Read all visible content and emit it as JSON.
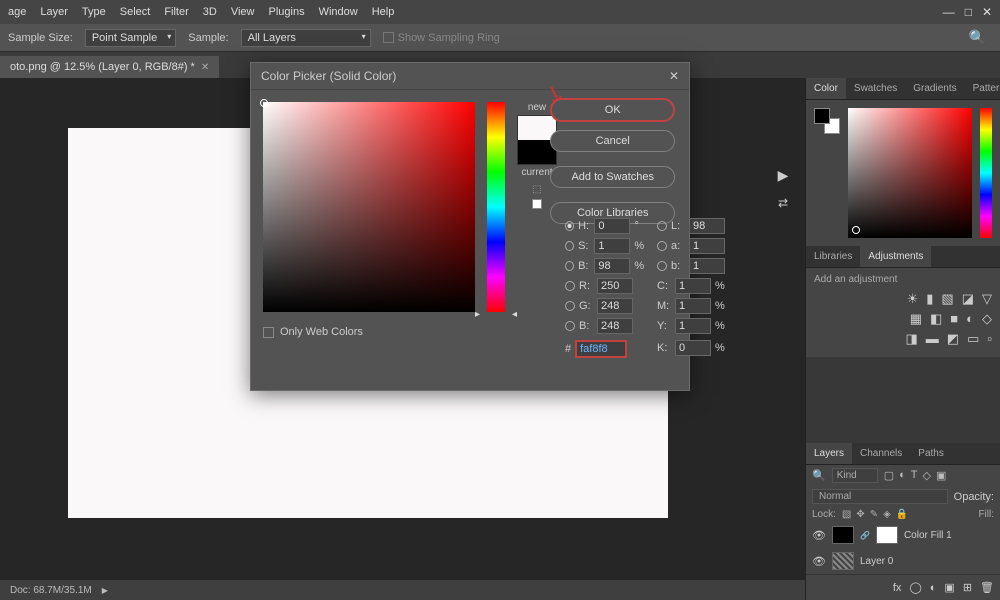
{
  "menubar": {
    "items": [
      "age",
      "Layer",
      "Type",
      "Select",
      "Filter",
      "3D",
      "View",
      "Plugins",
      "Window",
      "Help"
    ]
  },
  "optbar": {
    "sample_size_label": "Sample Size:",
    "sample_size_value": "Point Sample",
    "sample_label": "Sample:",
    "sample_value": "All Layers",
    "show_ring": "Show Sampling Ring"
  },
  "tab": {
    "title": "oto.png @ 12.5% (Layer 0, RGB/8#) *"
  },
  "dialog": {
    "title": "Color Picker (Solid Color)",
    "new_label": "new",
    "current_label": "current",
    "ok": "OK",
    "cancel": "Cancel",
    "add_swatches": "Add to Swatches",
    "libraries": "Color Libraries",
    "only_web": "Only Web Colors",
    "vals": {
      "H": "0",
      "S": "1",
      "B": "98",
      "R": "250",
      "G": "248",
      "Bb": "248",
      "L": "98",
      "a": "1",
      "b": "1",
      "C": "1",
      "M": "1",
      "Y": "1",
      "K": "0"
    },
    "hex": "faf8f8"
  },
  "statusbar": {
    "doc": "Doc: 68.7M/35.1M"
  },
  "right": {
    "color_tabs": [
      "Color",
      "Swatches",
      "Gradients",
      "Patterns"
    ],
    "lib_tabs": [
      "Libraries",
      "Adjustments"
    ],
    "adj_label": "Add an adjustment",
    "layer_tabs": [
      "Layers",
      "Channels",
      "Paths"
    ],
    "kind": "Kind",
    "blend": "Normal",
    "opacity_label": "Opacity:",
    "lock_label": "Lock:",
    "fill_label": "Fill:",
    "layers": [
      {
        "name": "Color Fill 1"
      },
      {
        "name": "Layer 0"
      }
    ]
  }
}
